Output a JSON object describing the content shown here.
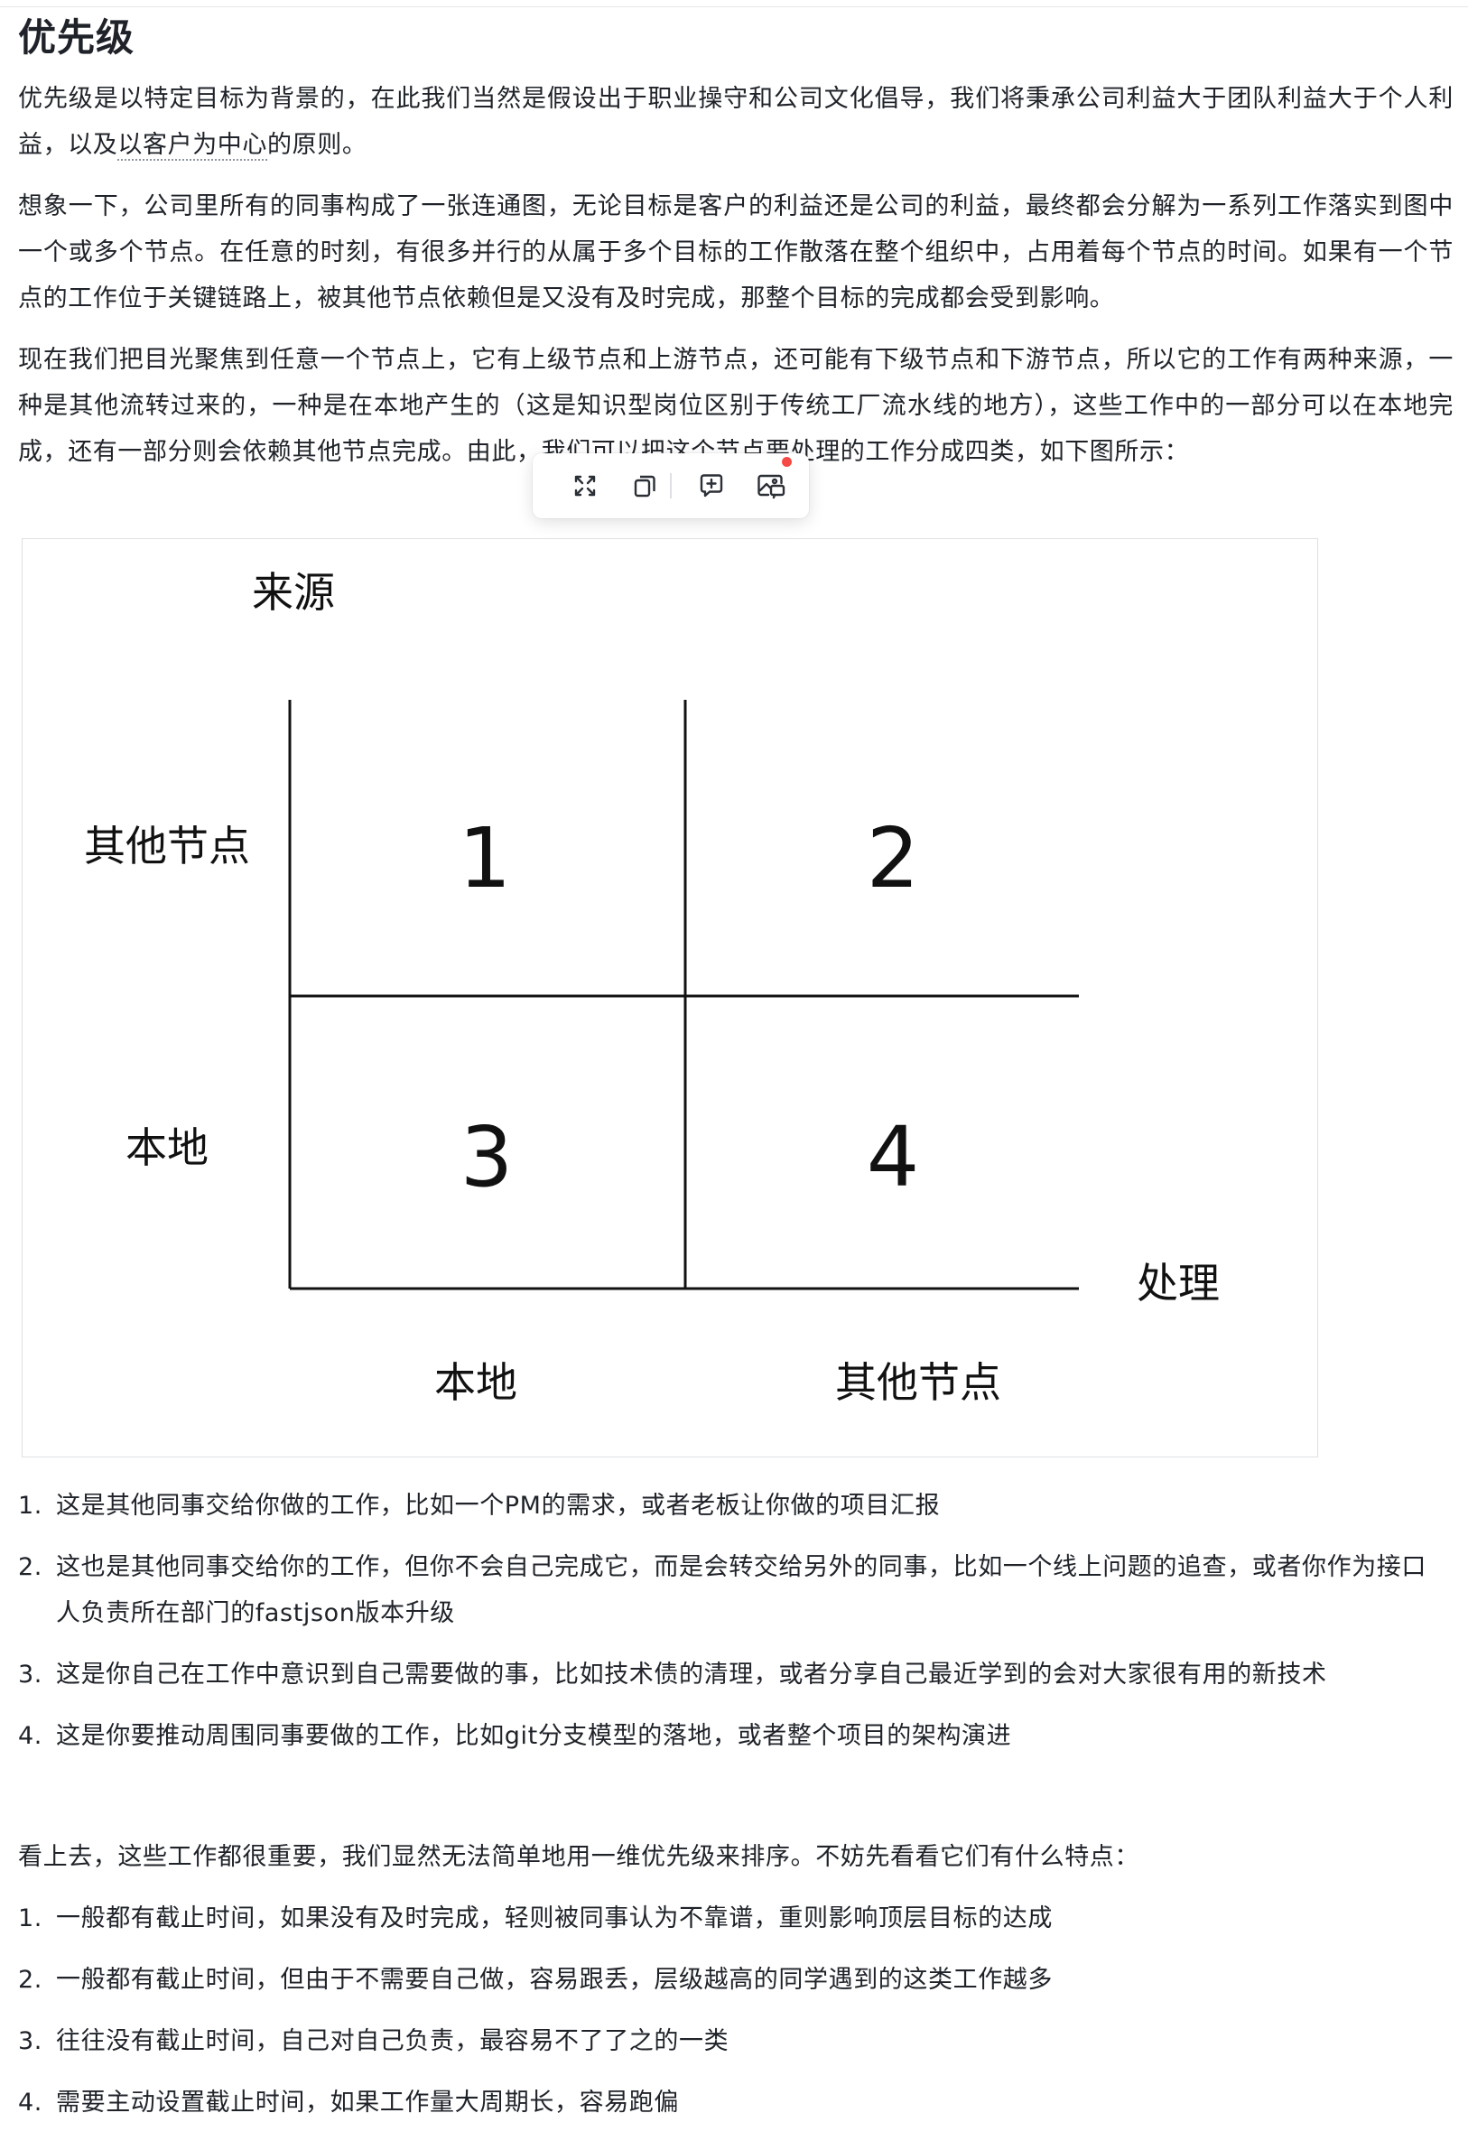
{
  "heading": "优先级",
  "intro": {
    "before_link": "优先级是以特定目标为背景的，在此我们当然是假设出于职业操守和公司文化倡导，我们将秉承公司利益大于团队利益大于个人利益，以及",
    "link_text": "以客户为中心",
    "after_link": "的原则。"
  },
  "paragraph_2": "想象一下，公司里所有的同事构成了一张连通图，无论目标是客户的利益还是公司的利益，最终都会分解为一系列工作落实到图中一个或多个节点。在任意的时刻，有很多并行的从属于多个目标的工作散落在整个组织中，占用着每个节点的时间。如果有一个节点的工作位于关键链路上，被其他节点依赖但是又没有及时完成，那整个目标的完成都会受到影响。",
  "paragraph_3": "现在我们把目光聚焦到任意一个节点上，它有上级节点和上游节点，还可能有下级节点和下游节点，所以它的工作有两种来源，一种是其他流转过来的，一种是在本地产生的（这是知识型岗位区别于传统工厂流水线的地方），这些工作中的一部分可以在本地完成，还有一部分则会依赖其他节点完成。由此，我们可以把这个节点要处理的工作分成四类，如下图所示：",
  "toolbar": {
    "fullscreen_icon": "expand-icon",
    "copy_icon": "copy-icon",
    "comment_icon": "comment-add-icon",
    "image_ai_icon": "image-chat-icon"
  },
  "diagram": {
    "y_axis_label": "来源",
    "x_axis_label": "处理",
    "row_labels": [
      "其他节点",
      "本地"
    ],
    "col_labels": [
      "本地",
      "其他节点"
    ],
    "cells": [
      "1",
      "2",
      "3",
      "4"
    ]
  },
  "list_a": [
    {
      "num": "1.",
      "text": "这是其他同事交给你做的工作，比如一个PM的需求，或者老板让你做的项目汇报"
    },
    {
      "num": "2.",
      "text": "这也是其他同事交给你的工作，但你不会自己完成它，而是会转交给另外的同事，比如一个线上问题的追查，或者你作为接口人负责所在部门的fastjson版本升级"
    },
    {
      "num": "3.",
      "text": "这是你自己在工作中意识到自己需要做的事，比如技术债的清理，或者分享自己最近学到的会对大家很有用的新技术"
    },
    {
      "num": "4.",
      "text": "这是你要推动周围同事要做的工作，比如git分支模型的落地，或者整个项目的架构演进"
    }
  ],
  "paragraph_4": "看上去，这些工作都很重要，我们显然无法简单地用一维优先级来排序。不妨先看看它们有什么特点：",
  "list_b": [
    {
      "num": "1.",
      "text": "一般都有截止时间，如果没有及时完成，轻则被同事认为不靠谱，重则影响顶层目标的达成"
    },
    {
      "num": "2.",
      "text": "一般都有截止时间，但由于不需要自己做，容易跟丢，层级越高的同学遇到的这类工作越多"
    },
    {
      "num": "3.",
      "text": "往往没有截止时间，自己对自己负责，最容易不了了之的一类"
    },
    {
      "num": "4.",
      "text": "需要主动设置截止时间，如果工作量大周期长，容易跑偏"
    }
  ]
}
